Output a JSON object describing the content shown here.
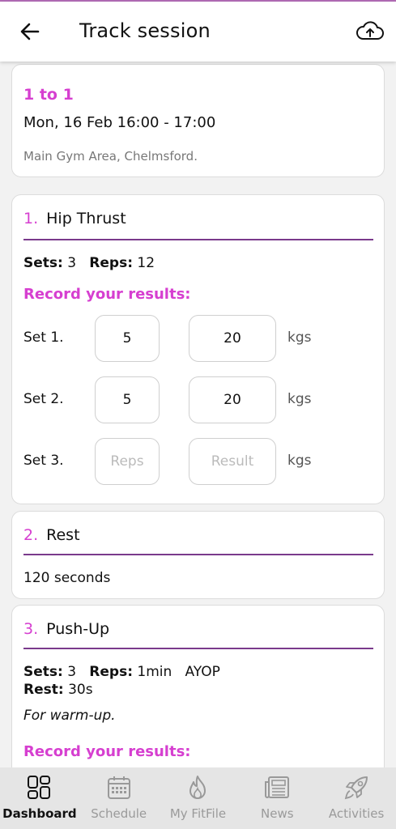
{
  "header": {
    "title": "Track session"
  },
  "session": {
    "type": "1 to 1",
    "when": "Mon, 16 Feb 16:00 - 17:00",
    "where": "Main Gym Area, Chelmsford."
  },
  "exercises": [
    {
      "num": "1.",
      "name": "Hip Thrust",
      "sets_label": "Sets:",
      "sets": "3",
      "reps_label": "Reps:",
      "reps": "12",
      "record_label": "Record your results:",
      "rows": [
        {
          "label": "Set 1.",
          "reps": "5",
          "result": "20",
          "unit": "kgs"
        },
        {
          "label": "Set 2.",
          "reps": "5",
          "result": "20",
          "unit": "kgs"
        },
        {
          "label": "Set 3.",
          "reps_placeholder": "Reps",
          "result_placeholder": "Result",
          "unit": "kgs"
        }
      ]
    },
    {
      "num": "2.",
      "name": "Rest",
      "detail": "120 seconds"
    },
    {
      "num": "3.",
      "name": "Push-Up",
      "sets_label": "Sets:",
      "sets": "3",
      "reps_label": "Reps:",
      "reps": "1min",
      "extra": "AYOP",
      "rest_label": "Rest:",
      "rest": "30s",
      "note": "For warm-up.",
      "record_label": "Record your results:"
    }
  ],
  "tabs": [
    {
      "label": "Dashboard",
      "icon": "dashboard-icon",
      "active": true
    },
    {
      "label": "Schedule",
      "icon": "calendar-icon"
    },
    {
      "label": "My FitFile",
      "icon": "flame-icon"
    },
    {
      "label": "News",
      "icon": "newspaper-icon"
    },
    {
      "label": "Activities",
      "icon": "rocket-icon"
    }
  ],
  "colors": {
    "accent": "#d63fd0",
    "rule": "#7a3a8c"
  }
}
